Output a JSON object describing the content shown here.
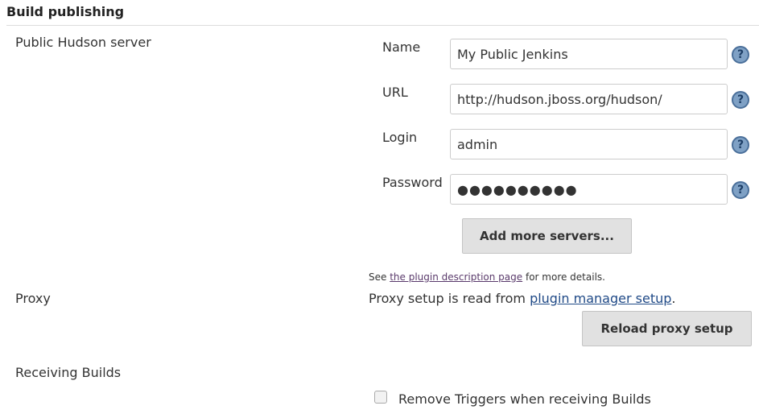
{
  "section": {
    "title": "Build publishing"
  },
  "public_server": {
    "label": "Public Hudson server",
    "fields": {
      "name": {
        "label": "Name",
        "value": "My Public Jenkins"
      },
      "url": {
        "label": "URL",
        "value": "http://hudson.jboss.org/hudson/"
      },
      "login": {
        "label": "Login",
        "value": "admin"
      },
      "password": {
        "label": "Password",
        "value": "●●●●●●●●●●"
      }
    },
    "help_icon": "question-circle-icon",
    "add_button": "Add more servers...",
    "description": {
      "prefix": "See ",
      "link": "the plugin description page",
      "suffix": " for more details."
    }
  },
  "proxy": {
    "label": "Proxy",
    "text_prefix": "Proxy setup is read from ",
    "link": "plugin manager setup",
    "text_suffix": ".",
    "reload_button": "Reload proxy setup"
  },
  "receiving": {
    "label": "Receiving Builds",
    "checkbox_label": "Remove Triggers when receiving Builds",
    "checked": false
  },
  "colors": {
    "help_icon": "#7fa1c5",
    "link": "#204a87",
    "button_bg": "#e1e1e1"
  }
}
